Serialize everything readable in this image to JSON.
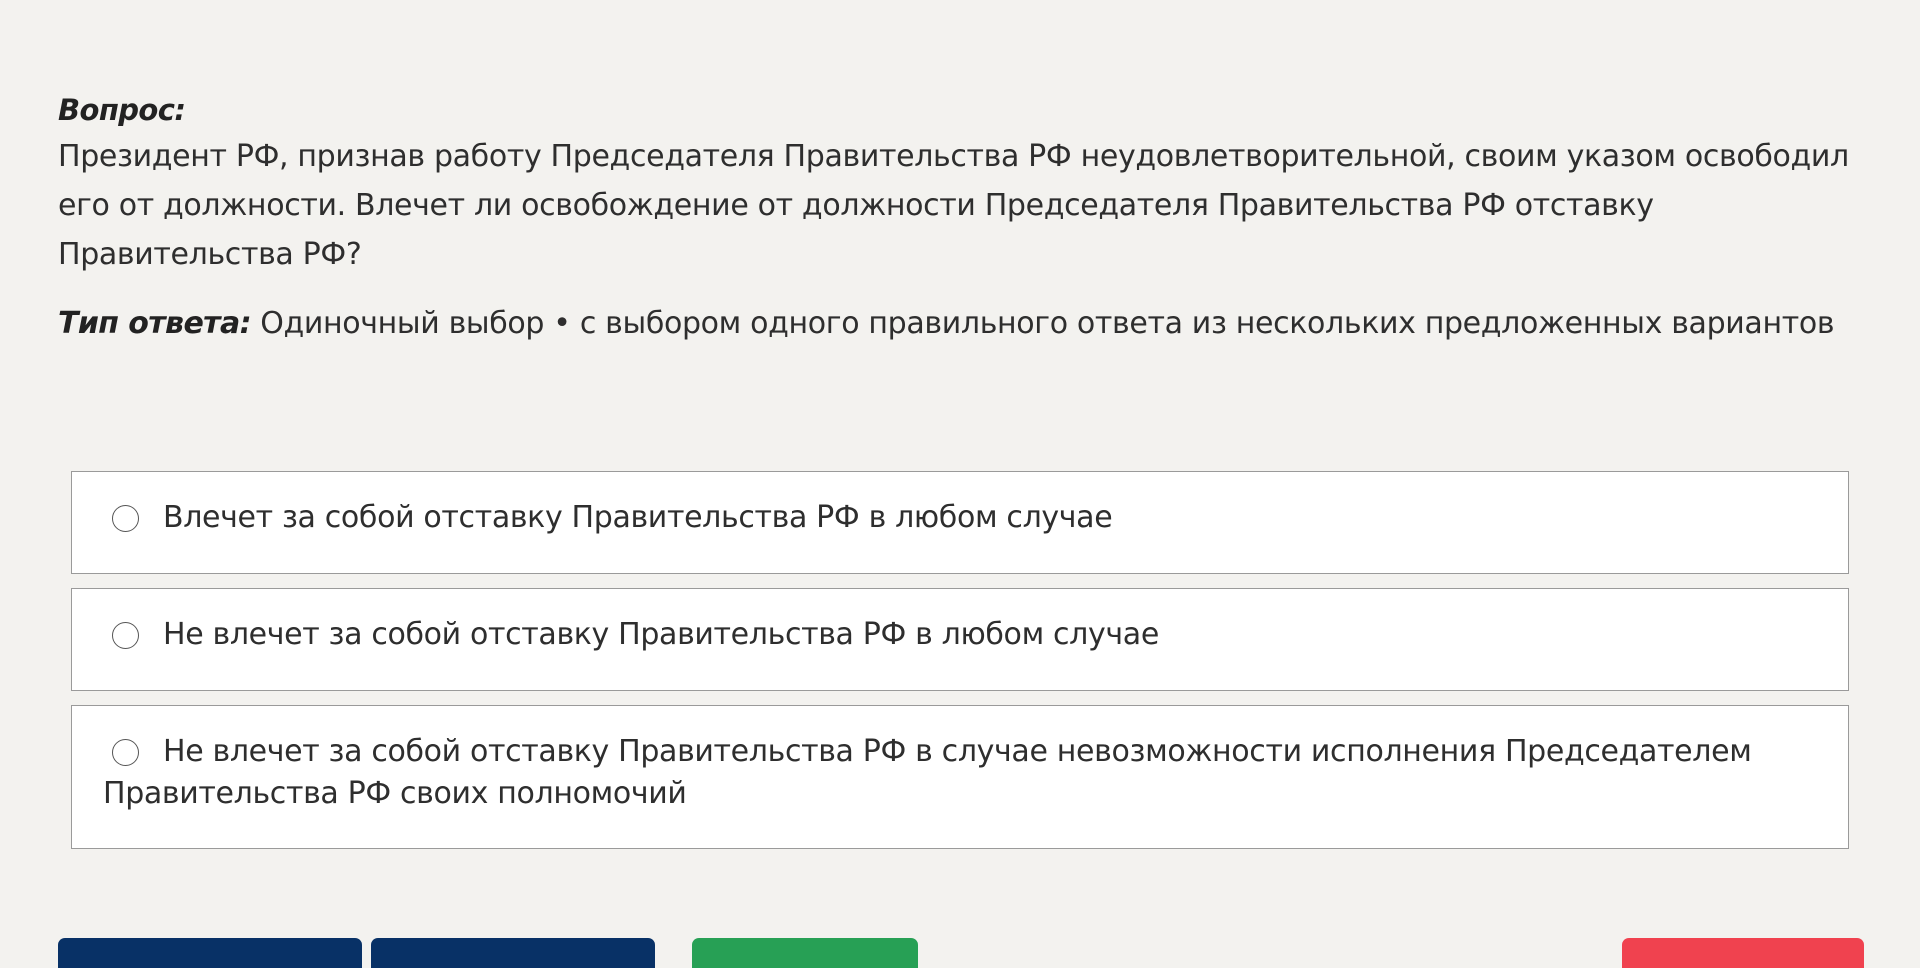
{
  "question": {
    "label": "Вопрос:",
    "text": "Президент РФ, признав работу Председателя Правительства РФ неудовлетворительной, своим указом освободил его от должности. Влечет ли освобождение от должности Председателя Правительства РФ отставку Правительства РФ?"
  },
  "answer_type": {
    "label": "Тип ответа:",
    "value": "Одиночный выбор • с выбором одного правильного ответа из нескольких предложенных вариантов"
  },
  "options": [
    {
      "label": "Влечет за собой отставку Правительства РФ в любом случае",
      "selected": false
    },
    {
      "label": "Не влечет за собой отставку Правительства РФ в любом случае",
      "selected": false
    },
    {
      "label": "Не влечет за собой отставку Правительства РФ в случае невозможности исполнения Председателем Правительства РФ своих полномочий",
      "selected": false
    }
  ],
  "colors": {
    "background": "#f3f2ef",
    "primary_button": "#083166",
    "submit_button": "#27a055",
    "danger_button": "#f0424f"
  }
}
